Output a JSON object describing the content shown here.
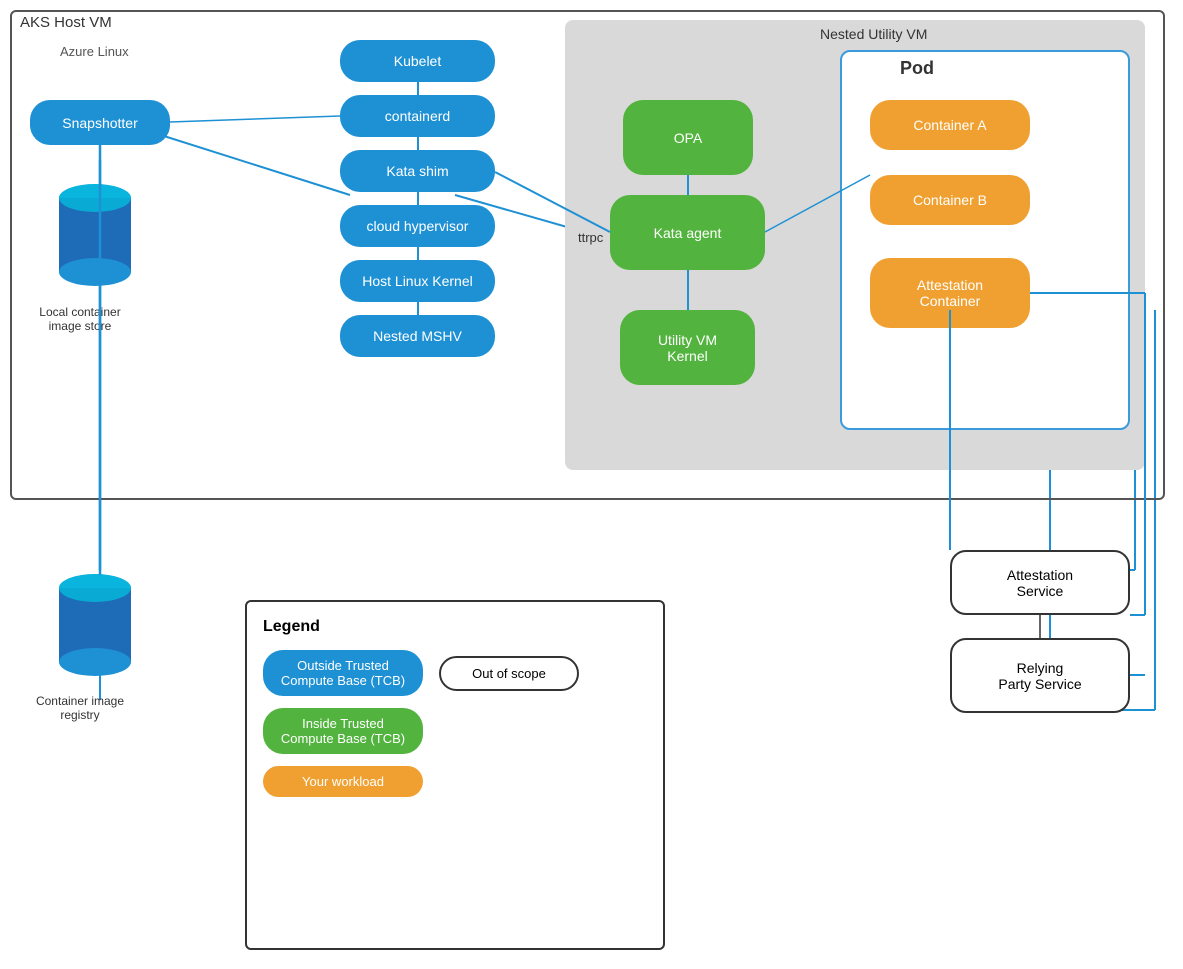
{
  "labels": {
    "aks_host": "AKS Host VM",
    "azure_linux": "Azure Linux",
    "nested_vm": "Nested Utility VM",
    "pod": "Pod",
    "kubelet": "Kubelet",
    "containerd": "containerd",
    "kata_shim": "Kata shim",
    "cloud_hypervisor": "cloud hypervisor",
    "host_linux_kernel": "Host Linux Kernel",
    "nested_mshv": "Nested MSHV",
    "opa": "OPA",
    "kata_agent": "Kata agent",
    "utility_vm_kernel": "Utility VM\nKernel",
    "ttrpc": "ttrpc",
    "container_a": "Container A",
    "container_b": "Container B",
    "attestation_container": "Attestation\nContainer",
    "snapshotter": "Snapshotter",
    "local_container_image_store": "Local container\nimage store",
    "container_image_registry": "Container image\nregistry",
    "attestation_service": "Attestation\nService",
    "relying_party_service": "Relying\nParty Service",
    "legend_title": "Legend",
    "outside_tcb": "Outside Trusted\nCompute Base (TCB)",
    "out_of_scope": "Out of scope",
    "inside_tcb": "Inside Trusted\nCompute Base (TCB)",
    "your_workload": "Your workload"
  }
}
